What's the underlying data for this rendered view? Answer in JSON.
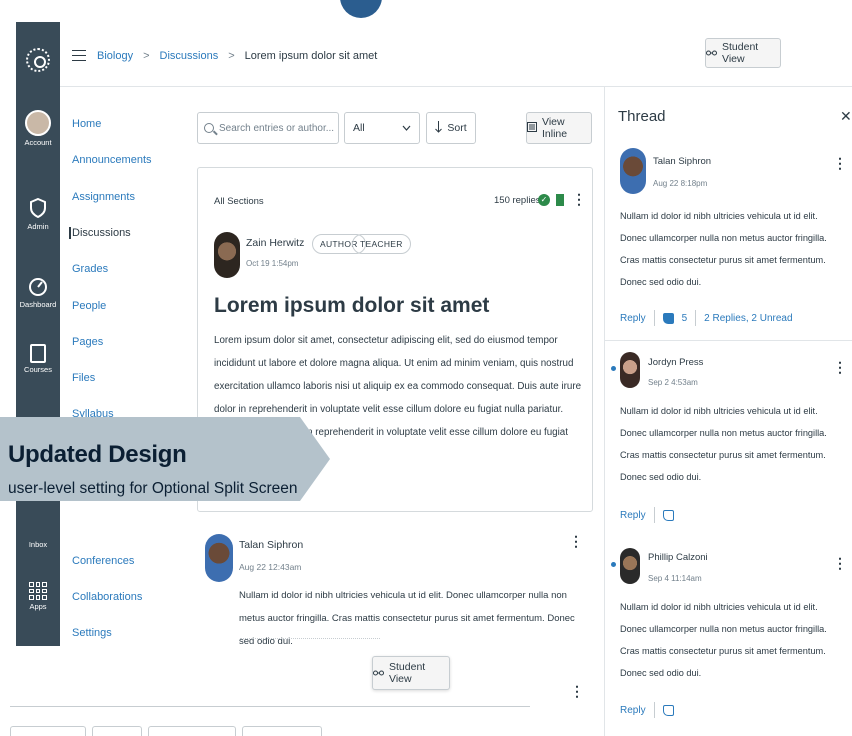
{
  "global_nav": {
    "items": [
      {
        "label": "Account",
        "icon": "avatar"
      },
      {
        "label": "Admin",
        "icon": "shield-icon"
      },
      {
        "label": "Dashboard",
        "icon": "speedometer-icon"
      },
      {
        "label": "Courses",
        "icon": "book-icon"
      },
      {
        "label": "Inbox",
        "icon": "inbox-icon"
      },
      {
        "label": "Apps",
        "icon": "apps-icon"
      }
    ]
  },
  "breadcrumb": {
    "course": "Biology",
    "section": "Discussions",
    "current": "Lorem ipsum dolor sit amet",
    "separator": ">"
  },
  "header": {
    "student_view_label": "Student View",
    "hamburger_icon": "hamburger-icon"
  },
  "course_nav": {
    "items": [
      "Home",
      "Announcements",
      "Assignments",
      "Discussions",
      "Grades",
      "People",
      "Pages",
      "Files",
      "Syllabus",
      "Conferences",
      "Collaborations",
      "Settings"
    ],
    "active": "Discussions"
  },
  "toolbar": {
    "search_placeholder": "Search entries or author...",
    "filter_value": "All",
    "sort_label": "Sort",
    "view_inline_label": "View Inline"
  },
  "post": {
    "sections": "All Sections",
    "replies": "150 replies",
    "author": "Zain Herwitz",
    "badges": [
      "AUTHOR",
      "TEACHER"
    ],
    "date": "Oct 19 1:54pm",
    "title": "Lorem ipsum dolor sit amet",
    "body": "Lorem ipsum dolor sit amet, consectetur adipiscing elit, sed do eiusmod tempor incididunt ut labore et dolore magna aliqua. Ut enim ad minim veniam, quis nostrud exercitation ullamco laboris nisi ut aliquip ex ea commodo consequat. Duis aute irure dolor in reprehenderit in voluptate velit esse cillum dolore eu fugiat nulla pariatur. Duis aute irure dolor in reprehenderit in voluptate velit esse cillum dolore eu fugiat nulla pariatur."
  },
  "reply": {
    "author": "Talan Siphron",
    "date": "Aug 22 12:43am",
    "body": "Nullam id dolor id nibh ultricies vehicula ut id elit. Donec ullamcorper nulla non metus auctor fringilla. Cras mattis consectetur purus sit amet fermentum. Donec sed odio dui."
  },
  "bottom": {
    "student_view_label": "Student View"
  },
  "thread": {
    "title": "Thread",
    "close_icon": "close-icon",
    "entries": [
      {
        "author": "Talan Siphron",
        "date": "Aug 22 8:18pm",
        "body": "Nullam id dolor id nibh ultricies vehicula ut id elit. Donec ullamcorper nulla non metus auctor fringilla. Cras mattis consectetur purus sit amet fermentum. Donec sed odio dui.",
        "reply_label": "Reply",
        "likes": "5",
        "replies_summary": "2 Replies, 2 Unread"
      },
      {
        "author": "Jordyn Press",
        "date": "Sep 2 4:53am",
        "body": "Nullam id dolor id nibh ultricies vehicula ut id elit. Donec ullamcorper nulla non metus auctor fringilla. Cras mattis consectetur purus sit amet fermentum. Donec sed odio dui.",
        "reply_label": "Reply"
      },
      {
        "author": "Phillip Calzoni",
        "date": "Sep 4 11:14am",
        "body": "Nullam id dolor id nibh ultricies vehicula ut id elit. Donec ullamcorper nulla non metus auctor fringilla. Cras mattis consectetur purus sit amet fermentum. Donec sed odio dui.",
        "reply_label": "Reply"
      }
    ]
  },
  "banner": {
    "title": "Updated Design",
    "subtitle": "user-level setting for Optional Split Screen"
  },
  "colors": {
    "nav_bg": "#394b58",
    "link": "#2b7abc",
    "success": "#2d8a4a",
    "banner_bg": "#b4c2cb",
    "banner_text": "#0b1f33"
  }
}
